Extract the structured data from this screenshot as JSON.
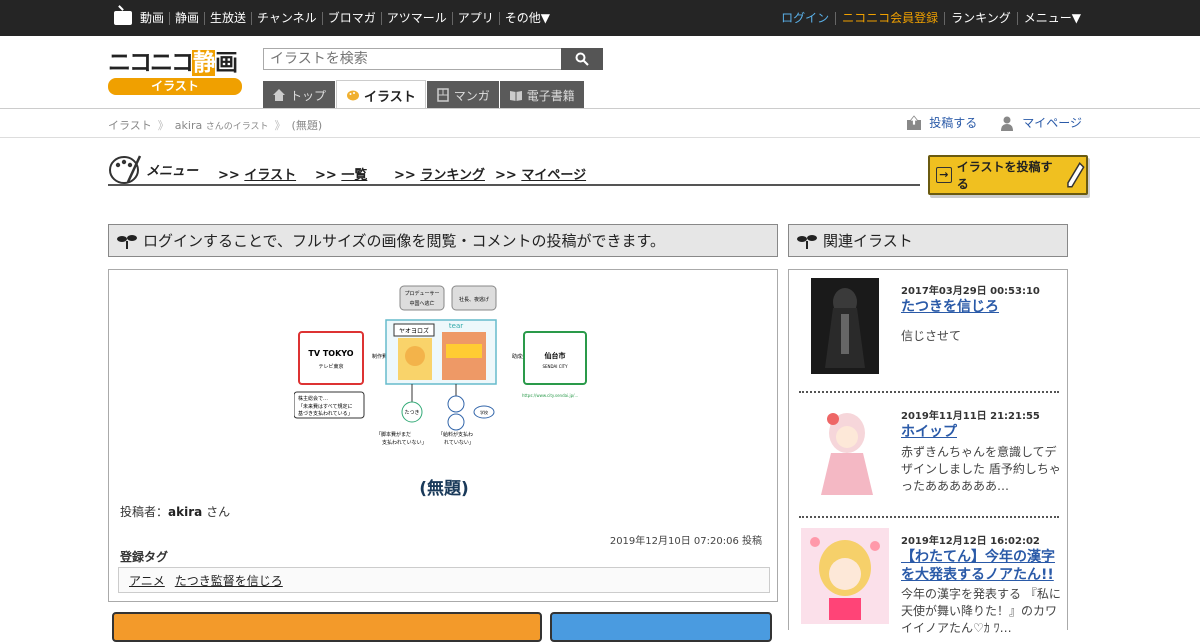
{
  "topbar": {
    "nav": [
      "動画",
      "静画",
      "生放送",
      "チャンネル",
      "ブロマガ",
      "アツマール",
      "アプリ",
      "その他▼"
    ],
    "login": "ログイン",
    "register": "ニコニコ会員登録",
    "ranking": "ランキング",
    "menu": "メニュー▼"
  },
  "header": {
    "logo_text_1": "ニコニコ",
    "logo_text_hl": "静",
    "logo_text_2": "画",
    "logo_badge": "イラスト",
    "search_placeholder": "イラストを検索",
    "tabs": [
      {
        "label": "トップ",
        "active": false
      },
      {
        "label": "イラスト",
        "active": true
      },
      {
        "label": "マンガ",
        "active": false
      },
      {
        "label": "電子書籍",
        "active": false
      }
    ]
  },
  "breadcrumb": {
    "items": [
      "イラスト",
      "akira",
      "さんのイラスト",
      "(無題)"
    ],
    "post": "投稿する",
    "mypage": "マイページ"
  },
  "menu": {
    "title": "メニュー",
    "links": [
      "イラスト",
      "一覧",
      "ランキング",
      "マイページ"
    ],
    "arrow": ">>",
    "post_button": "イラストを投稿する"
  },
  "main": {
    "notice": "ログインすることで、フルサイズの画像を閲覧・コメントの投稿ができます。",
    "title": "(無題)",
    "poster_label": "投稿者：",
    "poster_name": "akira",
    "poster_suffix": "さん",
    "post_date": "2019年12月10日 07:20:06 投稿",
    "tags_title": "登録タグ",
    "tags": [
      "アニメ",
      "たつき監督を信じろ"
    ]
  },
  "diagram": {
    "bubble_left_1": "プロデューサー",
    "bubble_left_2": "中国へ逃亡",
    "bubble_right": "社長、夜逃げ",
    "tv_logo": "TV TOKYO",
    "tv_sub": "テレビ東京",
    "label_seisaku": "制作費",
    "yaoyorozu": "ヤオヨロズ",
    "tear": "tear",
    "label_josei": "助成金",
    "sendai": "仙台市",
    "sendai_en": "SENDAI CITY",
    "note_box_1": "株主総会で…",
    "note_box_2": "「未来費はすべて規定に",
    "note_box_3": "基づき支払われている」",
    "tatsuki": "たつき",
    "gakkou": "学校",
    "quote_left_1": "「脚本費がまだ",
    "quote_left_2": "支払われていない」",
    "quote_right_1": "「給料が支払わ",
    "quote_right_2": "れていない」",
    "url": "https://www.city.sendai.jp/..."
  },
  "related": {
    "title": "関連イラスト",
    "items": [
      {
        "date": "2017年03月29日 00:53:10",
        "title": "たつきを信じろ",
        "desc": "信じさせて"
      },
      {
        "date": "2019年11月11日 21:21:55",
        "title": "ホイップ",
        "desc": "赤ずきんちゃんを意識してデザインしました 盾予約しちゃったああああああ…"
      },
      {
        "date": "2019年12月12日 16:02:02",
        "title": "【わたてん】今年の漢字を大発表するノアたん!!",
        "desc": "今年の漢字を発表する 『私に天使が舞い降りた！』のカワイイノアたん♡ｶ ﾜ…"
      }
    ]
  },
  "colors": {
    "topbar_bg": "#252525",
    "accent_orange": "#f0a000",
    "link_blue": "#2a5aa8",
    "title_navy": "#1a3a5a"
  }
}
